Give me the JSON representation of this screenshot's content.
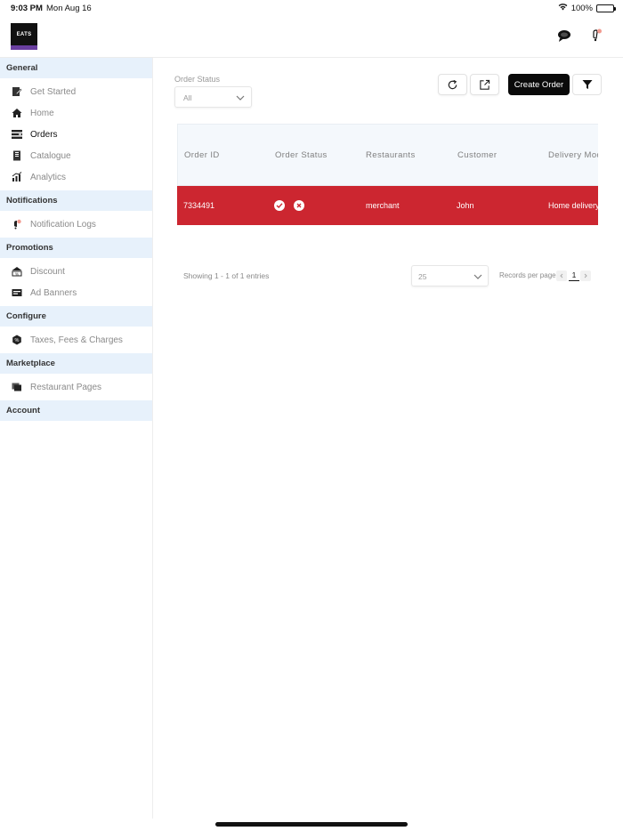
{
  "status_bar": {
    "time": "9:03 PM",
    "date": "Mon Aug 16",
    "battery": "100%"
  },
  "header": {
    "logo_text": "EATS"
  },
  "sidebar": {
    "sections": [
      {
        "title": "General",
        "items": [
          {
            "label": "Get Started",
            "icon": "get-started-icon",
            "active": false
          },
          {
            "label": "Home",
            "icon": "home-icon",
            "active": false
          },
          {
            "label": "Orders",
            "icon": "orders-icon",
            "active": true
          },
          {
            "label": "Catalogue",
            "icon": "catalogue-icon",
            "active": false
          },
          {
            "label": "Analytics",
            "icon": "analytics-icon",
            "active": false
          }
        ]
      },
      {
        "title": "Notifications",
        "items": [
          {
            "label": "Notification Logs",
            "icon": "notification-logs-icon",
            "active": false
          }
        ]
      },
      {
        "title": "Promotions",
        "items": [
          {
            "label": "Discount",
            "icon": "discount-icon",
            "active": false
          },
          {
            "label": "Ad Banners",
            "icon": "ad-banners-icon",
            "active": false
          }
        ]
      },
      {
        "title": "Configure",
        "items": [
          {
            "label": "Taxes, Fees & Charges",
            "icon": "taxes-icon",
            "active": false
          }
        ]
      },
      {
        "title": "Marketplace",
        "items": [
          {
            "label": "Restaurant Pages",
            "icon": "restaurant-pages-icon",
            "active": false
          }
        ]
      },
      {
        "title": "Account",
        "items": []
      }
    ]
  },
  "filters": {
    "order_status_label": "Order Status",
    "order_status_value": "All"
  },
  "toolbar": {
    "create_order_label": "Create Order"
  },
  "table": {
    "columns": [
      "Order ID",
      "Order Status",
      "Restaurants",
      "Customer",
      "Delivery Mode"
    ],
    "rows": [
      {
        "order_id": "7334491",
        "restaurant": "merchant",
        "customer": "John",
        "delivery_mode": "Home delivery"
      }
    ]
  },
  "pagination": {
    "showing_text": "Showing 1 - 1 of 1 entries",
    "page_size": "25",
    "records_per_page_label": "Records per page",
    "current_page": "1"
  },
  "colors": {
    "row_highlight": "#cc2630",
    "section_bg": "#e7f1fb",
    "primary_button": "#0a0a0a"
  }
}
